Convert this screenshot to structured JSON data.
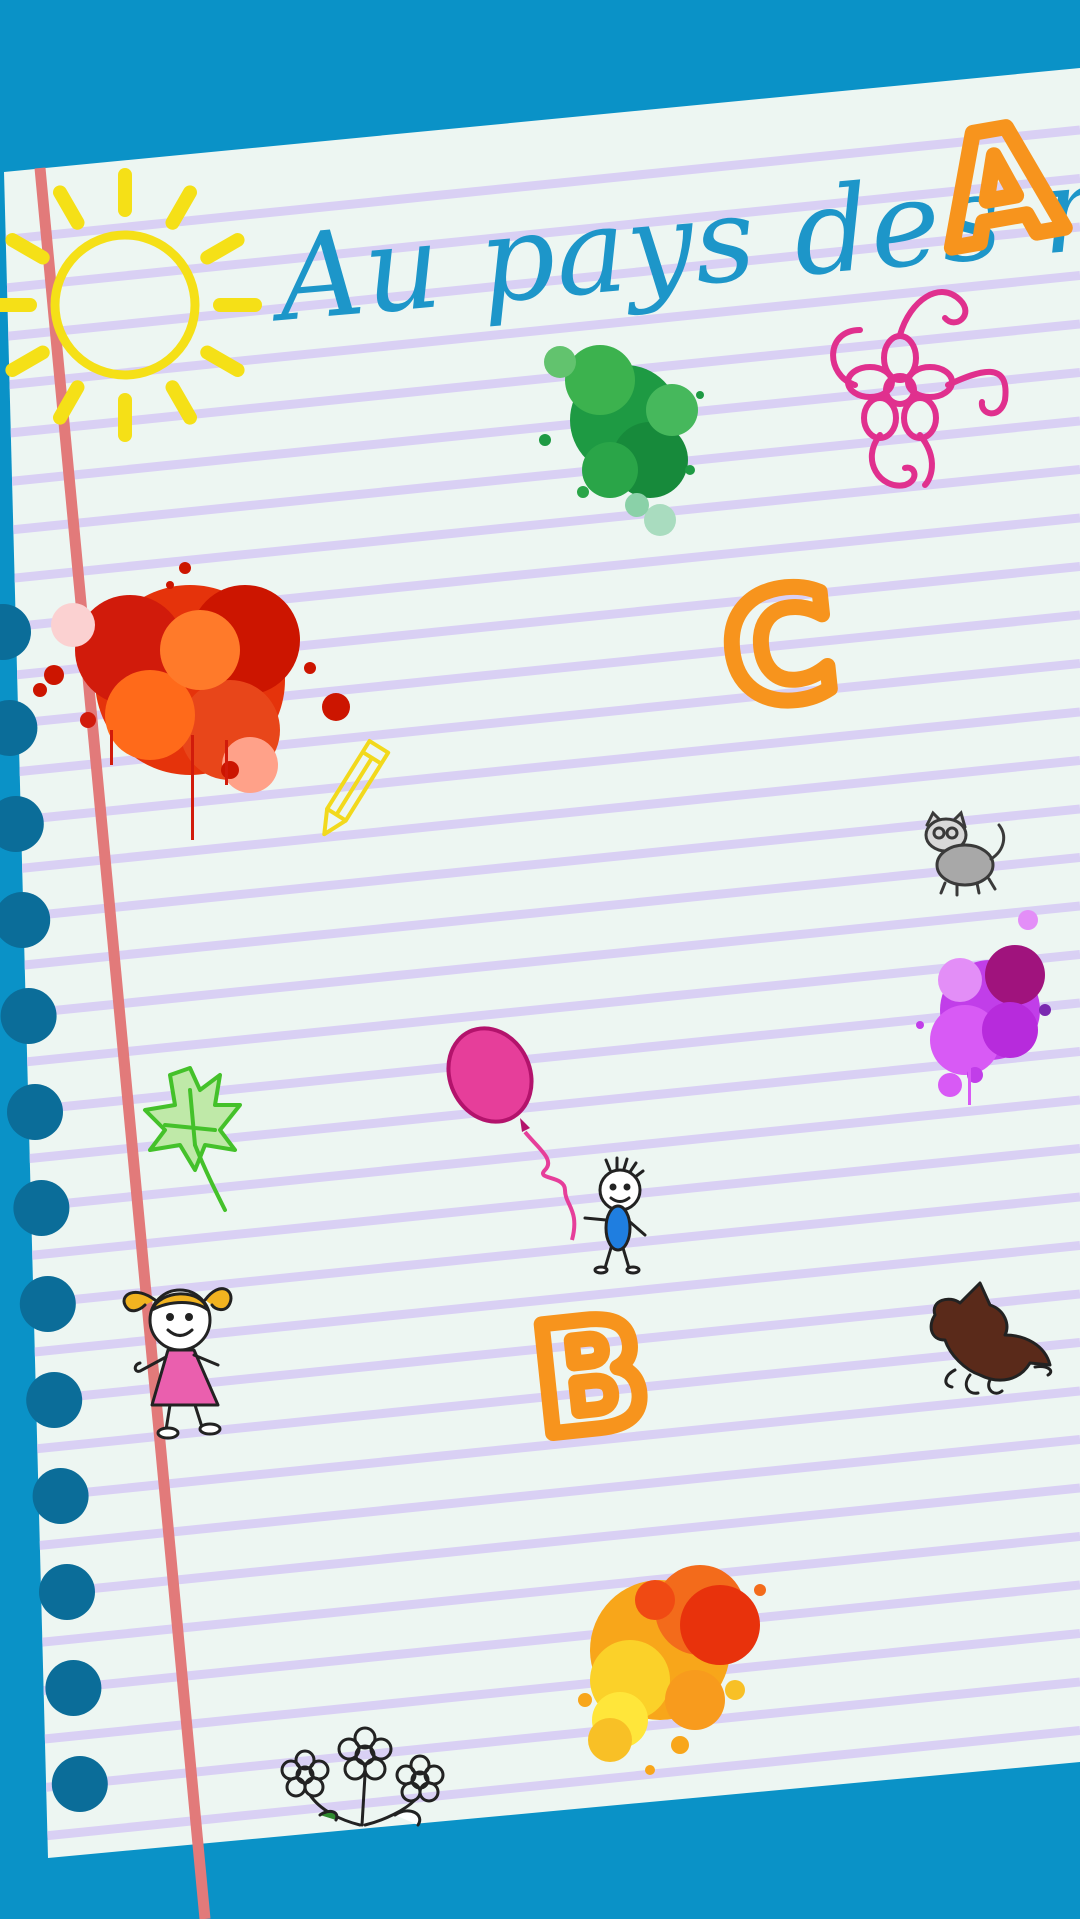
{
  "game": {
    "title": "Au pays des mots"
  },
  "letters": {
    "a": "A",
    "b": "B",
    "c": "C"
  },
  "colors": {
    "background": "#0a92c7",
    "paper": "#edf6f2",
    "rule_line": "#d9d0f4",
    "margin_line": "#e27a7a",
    "binder_hole": "#0b6d99",
    "title": "#1d96c9",
    "letters": "#f7941d",
    "sun": "#f5e017"
  },
  "decorations": [
    "sun-icon",
    "flower-swirl-icon",
    "green-paint-splash",
    "red-paint-splash",
    "pencil-icon",
    "cat-icon",
    "purple-paint-splash",
    "balloon-icon",
    "stick-boy-icon",
    "leaf-icon",
    "girl-icon",
    "dog-icon",
    "orange-paint-splash",
    "flowers-icon"
  ]
}
